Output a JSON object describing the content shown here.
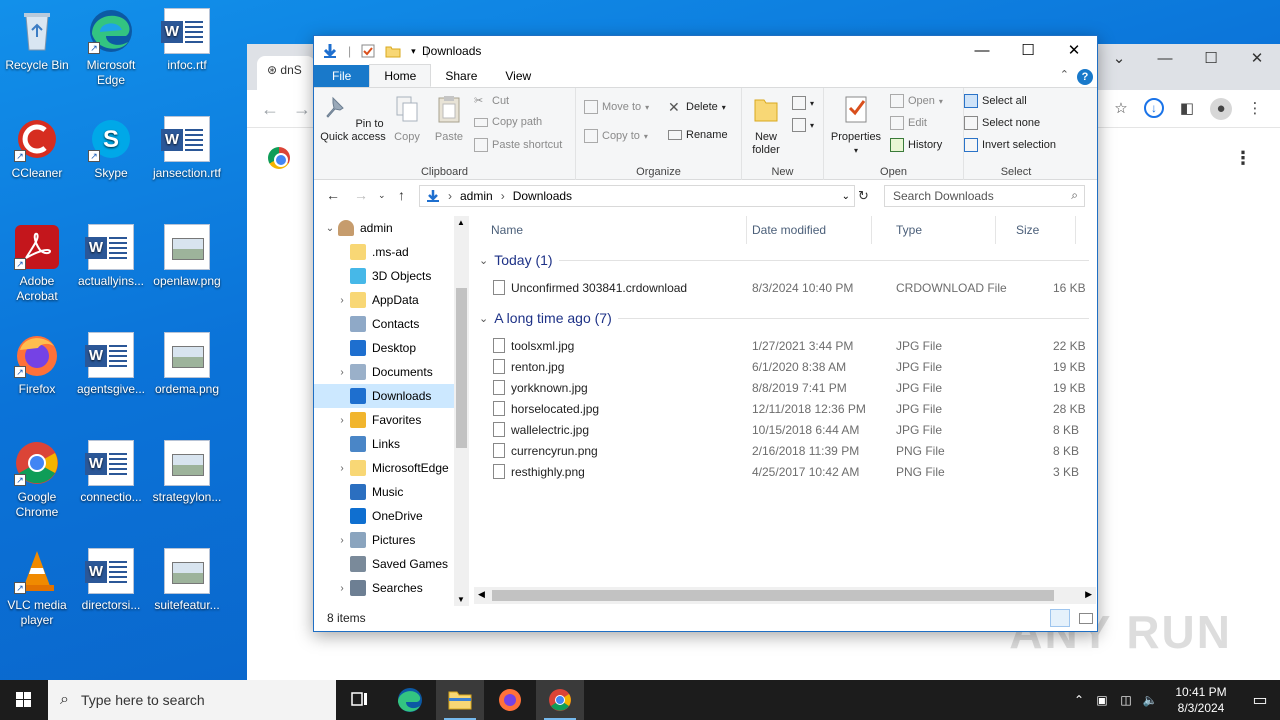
{
  "desktop": {
    "icons": [
      {
        "label": "Recycle Bin"
      },
      {
        "label": "Microsoft Edge"
      },
      {
        "label": "infoc.rtf"
      },
      {
        "label": "CCleaner"
      },
      {
        "label": "Skype"
      },
      {
        "label": "jansection.rtf"
      },
      {
        "label": "Adobe Acrobat"
      },
      {
        "label": "actuallyins..."
      },
      {
        "label": "openlaw.png"
      },
      {
        "label": "Firefox"
      },
      {
        "label": "agentsgive..."
      },
      {
        "label": "ordema.png"
      },
      {
        "label": "Google Chrome"
      },
      {
        "label": "connectio..."
      },
      {
        "label": "strategylon..."
      },
      {
        "label": "VLC media player"
      },
      {
        "label": "directorsi..."
      },
      {
        "label": "suitefeatur..."
      }
    ],
    "watermark": "ANY RUN"
  },
  "chrome": {
    "tab_title": "dnS"
  },
  "explorer": {
    "title": "Downloads",
    "tabs": {
      "file": "File",
      "home": "Home",
      "share": "Share",
      "view": "View"
    },
    "ribbon": {
      "clipboard": {
        "label": "Clipboard",
        "pin": "Pin to Quick access",
        "copy": "Copy",
        "paste": "Paste",
        "cut": "Cut",
        "copy_path": "Copy path",
        "paste_shortcut": "Paste shortcut"
      },
      "organize": {
        "label": "Organize",
        "move_to": "Move to",
        "copy_to": "Copy to",
        "delete": "Delete",
        "rename": "Rename"
      },
      "new": {
        "label": "New",
        "new_folder": "New folder"
      },
      "open": {
        "label": "Open",
        "properties": "Properties",
        "open": "Open",
        "edit": "Edit",
        "history": "History"
      },
      "select": {
        "label": "Select",
        "select_all": "Select all",
        "select_none": "Select none",
        "invert": "Invert selection"
      }
    },
    "address": {
      "crumbs": [
        "admin",
        "Downloads"
      ],
      "search_placeholder": "Search Downloads"
    },
    "nav": [
      {
        "label": "admin",
        "expanded": true
      },
      {
        "label": ".ms-ad"
      },
      {
        "label": "3D Objects"
      },
      {
        "label": "AppData"
      },
      {
        "label": "Contacts"
      },
      {
        "label": "Desktop"
      },
      {
        "label": "Documents"
      },
      {
        "label": "Downloads",
        "selected": true
      },
      {
        "label": "Favorites"
      },
      {
        "label": "Links"
      },
      {
        "label": "MicrosoftEdge"
      },
      {
        "label": "Music"
      },
      {
        "label": "OneDrive"
      },
      {
        "label": "Pictures"
      },
      {
        "label": "Saved Games"
      },
      {
        "label": "Searches"
      }
    ],
    "columns": {
      "name": "Name",
      "date": "Date modified",
      "type": "Type",
      "size": "Size"
    },
    "groups": [
      {
        "label": "Today (1)",
        "files": [
          {
            "name": "Unconfirmed 303841.crdownload",
            "date": "8/3/2024 10:40 PM",
            "type": "CRDOWNLOAD File",
            "size": "16 KB"
          }
        ]
      },
      {
        "label": "A long time ago (7)",
        "files": [
          {
            "name": "toolsxml.jpg",
            "date": "1/27/2021 3:44 PM",
            "type": "JPG File",
            "size": "22 KB"
          },
          {
            "name": "renton.jpg",
            "date": "6/1/2020 8:38 AM",
            "type": "JPG File",
            "size": "19 KB"
          },
          {
            "name": "yorkknown.jpg",
            "date": "8/8/2019 7:41 PM",
            "type": "JPG File",
            "size": "19 KB"
          },
          {
            "name": "horselocated.jpg",
            "date": "12/11/2018 12:36 PM",
            "type": "JPG File",
            "size": "28 KB"
          },
          {
            "name": "wallelectric.jpg",
            "date": "10/15/2018 6:44 AM",
            "type": "JPG File",
            "size": "8 KB"
          },
          {
            "name": "currencyrun.png",
            "date": "2/16/2018 11:39 PM",
            "type": "PNG File",
            "size": "8 KB"
          },
          {
            "name": "resthighly.png",
            "date": "4/25/2017 10:42 AM",
            "type": "PNG File",
            "size": "3 KB"
          }
        ]
      }
    ],
    "status": "8 items"
  },
  "taskbar": {
    "search_placeholder": "Type here to search",
    "time": "10:41 PM",
    "date": "8/3/2024"
  },
  "colors": {
    "accent": "#1979ca",
    "desktop": "#0b73d8",
    "taskbar": "#1c1c1c"
  }
}
